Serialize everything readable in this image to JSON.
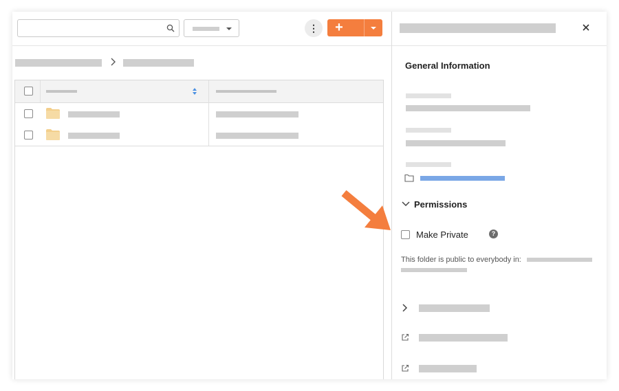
{
  "accent": "#f47e3e",
  "link_color": "#7aa7e6",
  "toolbar": {
    "search_placeholder": "",
    "search_icon": "search-icon",
    "create_symbol": "+",
    "more_symbol": "⋮"
  },
  "detail_panel": {
    "close_icon": "close-icon",
    "section_title": "General Information",
    "permissions_title": "Permissions",
    "make_private_label": "Make Private",
    "help_symbol": "?",
    "public_text": "This folder is public to everybody in:"
  },
  "table": {
    "rows": [
      {
        "type": "folder"
      },
      {
        "type": "folder"
      }
    ]
  }
}
